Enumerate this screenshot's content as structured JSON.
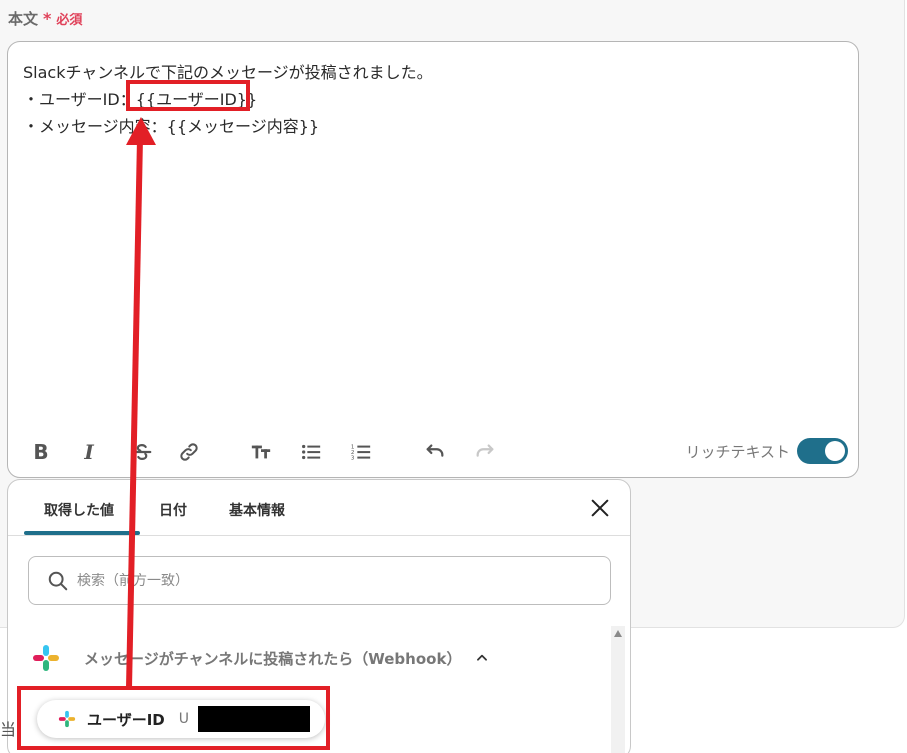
{
  "field": {
    "label": "本文",
    "required_mark": "*",
    "required_text": "必須"
  },
  "editor": {
    "lines": [
      "Slackチャンネルで下記のメッセージが投稿されました。",
      "・ユーザーID：{{ユーザーID}}",
      "・メッセージ内容：{{メッセージ内容}}"
    ],
    "rich_text_label": "リッチテキスト",
    "rich_text_enabled": true,
    "toolbar_icons": [
      "bold-icon",
      "italic-icon",
      "strikethrough-icon",
      "link-icon",
      "text-size-icon",
      "bullet-list-icon",
      "numbered-list-icon",
      "undo-icon",
      "redo-icon"
    ]
  },
  "popover": {
    "tabs": [
      {
        "label": "取得した値",
        "active": true
      },
      {
        "label": "日付",
        "active": false
      },
      {
        "label": "基本情報",
        "active": false
      }
    ],
    "search_placeholder": "検索（前方一致）",
    "group": {
      "title": "メッセージがチャンネルに投稿されたら（Webhook）",
      "icon": "slack-icon",
      "expanded": true
    },
    "item": {
      "label": "ユーザーID",
      "value_prefix": "U",
      "icon": "slack-icon"
    }
  },
  "colors": {
    "accent": "#1f6f8b",
    "required": "#e0425a",
    "annotation": "#e21f26"
  },
  "edge_text": "当"
}
